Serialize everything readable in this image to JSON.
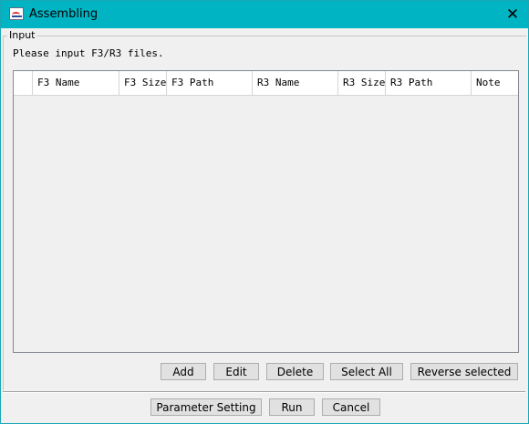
{
  "window": {
    "title": "Assembling",
    "close_symbol": "✕"
  },
  "input_group": {
    "label": "Input",
    "instruction": "Please input F3/R3 files."
  },
  "table": {
    "columns": [
      {
        "label": ""
      },
      {
        "label": "F3 Name"
      },
      {
        "label": "F3 Size"
      },
      {
        "label": "F3 Path"
      },
      {
        "label": "R3 Name"
      },
      {
        "label": "R3 Size"
      },
      {
        "label": "R3 Path"
      },
      {
        "label": "Note"
      }
    ],
    "rows": []
  },
  "table_buttons": {
    "add": "Add",
    "edit": "Edit",
    "delete": "Delete",
    "select_all": "Select All",
    "reverse_selected": "Reverse selected"
  },
  "footer_buttons": {
    "parameter_setting": "Parameter Setting",
    "run": "Run",
    "cancel": "Cancel"
  },
  "icons": {
    "app": "app-logo-icon",
    "close": "close-icon"
  },
  "colors": {
    "titlebar": "#00b4c4",
    "background": "#f0f0f0"
  }
}
